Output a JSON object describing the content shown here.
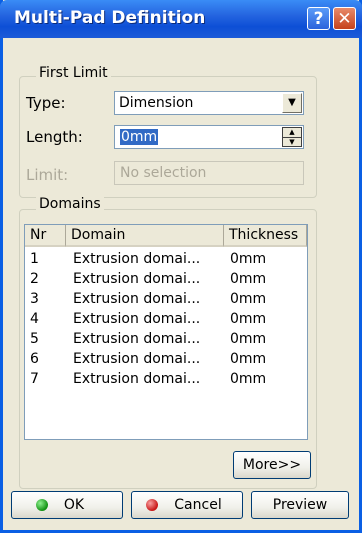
{
  "window": {
    "title": "Multi-Pad Definition",
    "help_glyph": "?",
    "close_glyph": "✕"
  },
  "first_limit": {
    "legend": "First Limit",
    "type_label": "Type:",
    "type_value": "Dimension",
    "length_label": "Length:",
    "length_value": "0mm",
    "limit_label": "Limit:",
    "limit_value": "No selection"
  },
  "domains": {
    "legend": "Domains",
    "columns": [
      "Nr",
      "Domain",
      "Thickness"
    ],
    "rows": [
      {
        "nr": "1",
        "domain": "Extrusion domai...",
        "thickness": "0mm"
      },
      {
        "nr": "2",
        "domain": "Extrusion domai...",
        "thickness": "0mm"
      },
      {
        "nr": "3",
        "domain": "Extrusion domai...",
        "thickness": "0mm"
      },
      {
        "nr": "4",
        "domain": "Extrusion domai...",
        "thickness": "0mm"
      },
      {
        "nr": "5",
        "domain": "Extrusion domai...",
        "thickness": "0mm"
      },
      {
        "nr": "6",
        "domain": "Extrusion domai...",
        "thickness": "0mm"
      },
      {
        "nr": "7",
        "domain": "Extrusion domai...",
        "thickness": "0mm"
      }
    ]
  },
  "buttons": {
    "more": "More>>",
    "ok": "OK",
    "cancel": "Cancel",
    "preview": "Preview"
  }
}
